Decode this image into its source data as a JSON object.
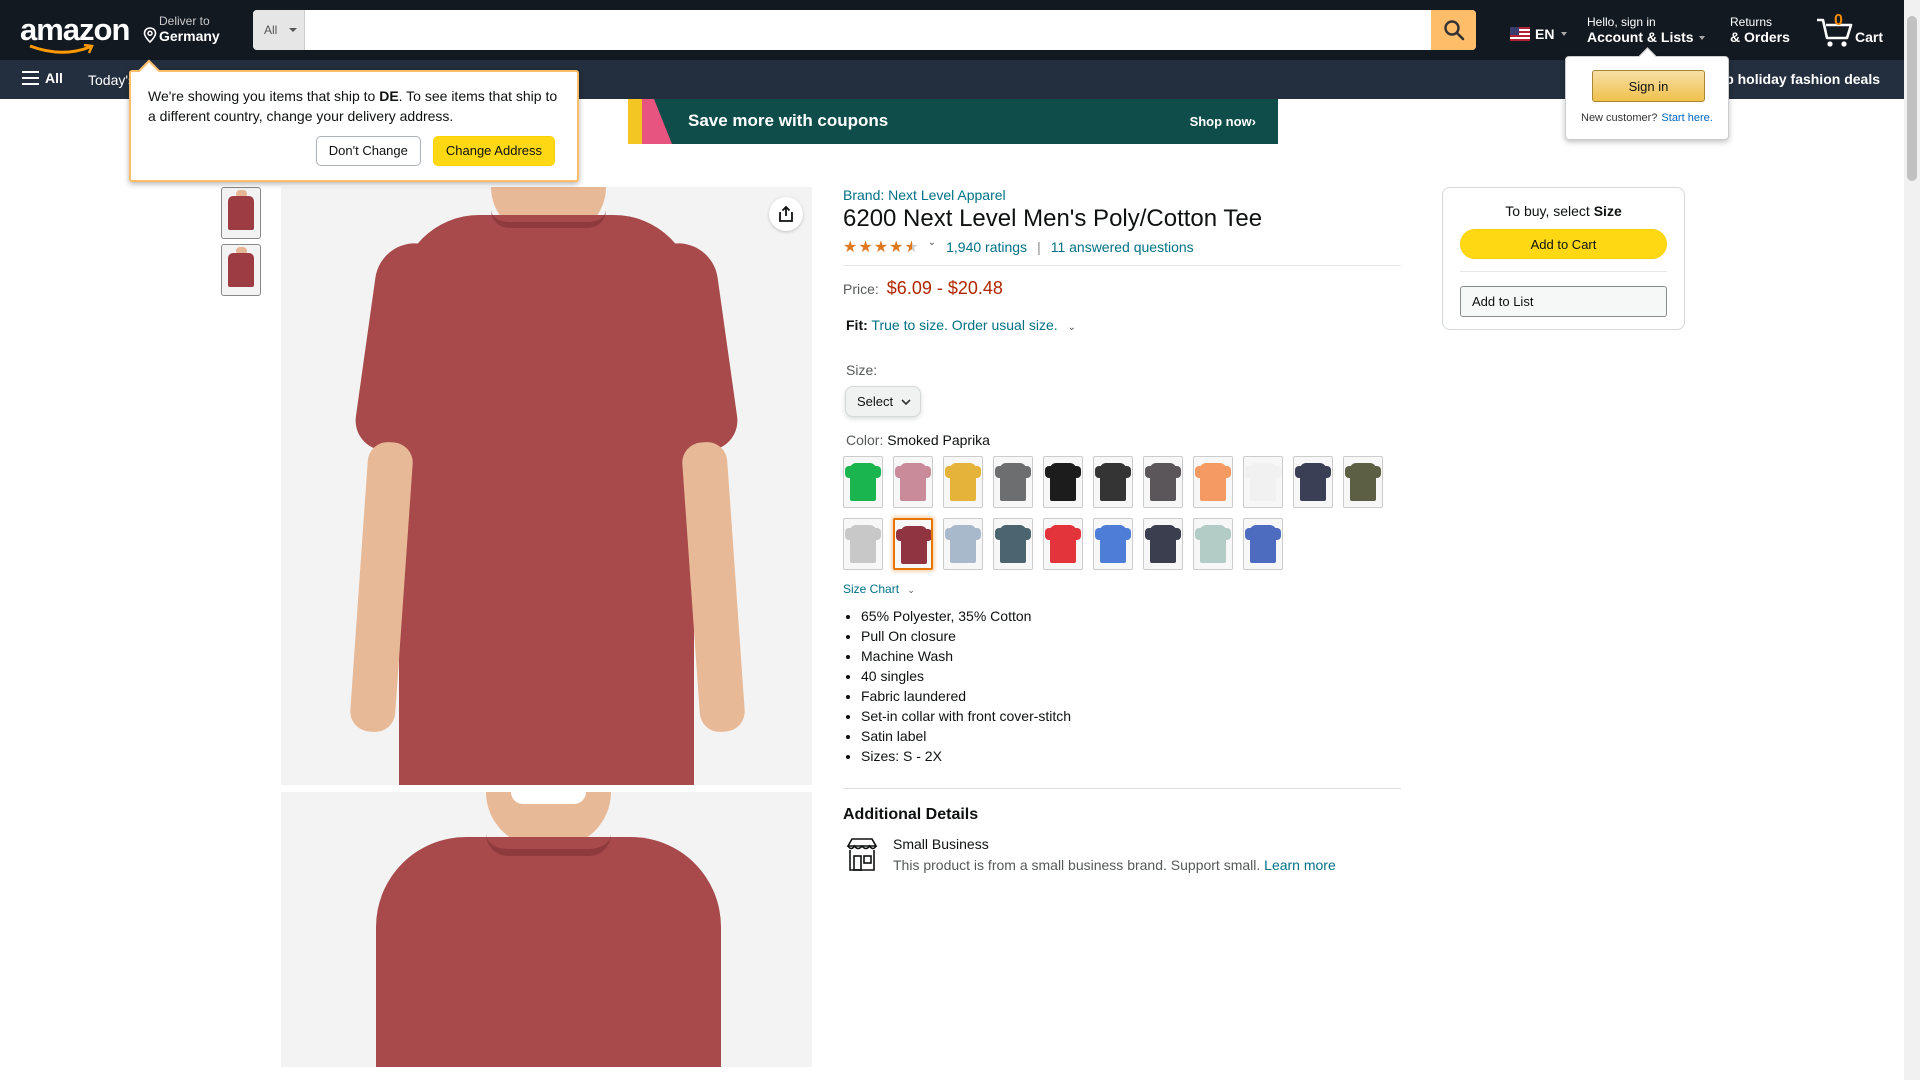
{
  "header": {
    "logo_text": "amazon",
    "deliver_line1": "Deliver to",
    "deliver_line2": "Germany",
    "search_category": "All",
    "search_placeholder": "",
    "language": "EN",
    "account_line1": "Hello, sign in",
    "account_line2": "Account & Lists",
    "returns_line1": "Returns",
    "returns_line2": "& Orders",
    "cart_count": "0",
    "cart_label": "Cart"
  },
  "subnav": {
    "all_label": "All",
    "todays_deals": "Today's",
    "holiday_link": "p holiday fashion deals"
  },
  "banner": {
    "text": "Save more with coupons",
    "cta": "Shop now›"
  },
  "ship_popover": {
    "text_before": "We're showing you items that ship to ",
    "country": "DE",
    "text_after": ". To see items that ship to a different country, change your delivery address.",
    "dont_change": "Don't Change",
    "change_address": "Change Address"
  },
  "signin_popover": {
    "button": "Sign in",
    "new_customer": "New customer?",
    "start_here": "Start here."
  },
  "product": {
    "brand": "Brand: Next Level Apparel",
    "title": "6200 Next Level Men's Poly/Cotton Tee",
    "rating_count": "1,940 ratings",
    "answered": "11 answered questions",
    "price_label": "Price:",
    "price": "$6.09 - $20.48",
    "fit_label": "Fit:",
    "fit_value": "True to size. Order usual size.",
    "size_label": "Size:",
    "size_select": "Select",
    "color_label": "Color:",
    "color_value": "Smoked Paprika",
    "size_chart": "Size Chart",
    "bullets": [
      "65% Polyester, 35% Cotton",
      "Pull On closure",
      "Machine Wash",
      "40 singles",
      "Fabric laundered",
      "Set-in collar with front cover-stitch",
      "Satin label",
      "Sizes: S - 2X"
    ],
    "additional_heading": "Additional Details",
    "small_business_title": "Small Business",
    "small_business_desc": "This product is from a small business brand. Support small.",
    "learn_more": "Learn more"
  },
  "swatch_colors": [
    "#1ab54f",
    "#c98a9a",
    "#e6b33a",
    "#6d6e70",
    "#1c1c1c",
    "#343434",
    "#5a5659",
    "#f59a62",
    "#f1f1f1",
    "#3b3f55",
    "#5d5f45",
    "#c8c8c8",
    "#8f3440",
    "#a9b9cc",
    "#4a6570",
    "#e3333b",
    "#4d7dd6",
    "#3a3e4f",
    "#b4ccc6",
    "#4d6cc0"
  ],
  "selected_swatch": 12,
  "buybox": {
    "heading_prefix": "To buy, select ",
    "heading_bold": "Size",
    "add_to_cart": "Add to Cart",
    "add_to_list": "Add to List"
  },
  "colors": {
    "nav_dark": "#131921",
    "nav_sub": "#232f3e",
    "accent_yellow": "#ffd814",
    "link": "#007185",
    "price": "#b12704",
    "shirt": "#a84a4c"
  }
}
